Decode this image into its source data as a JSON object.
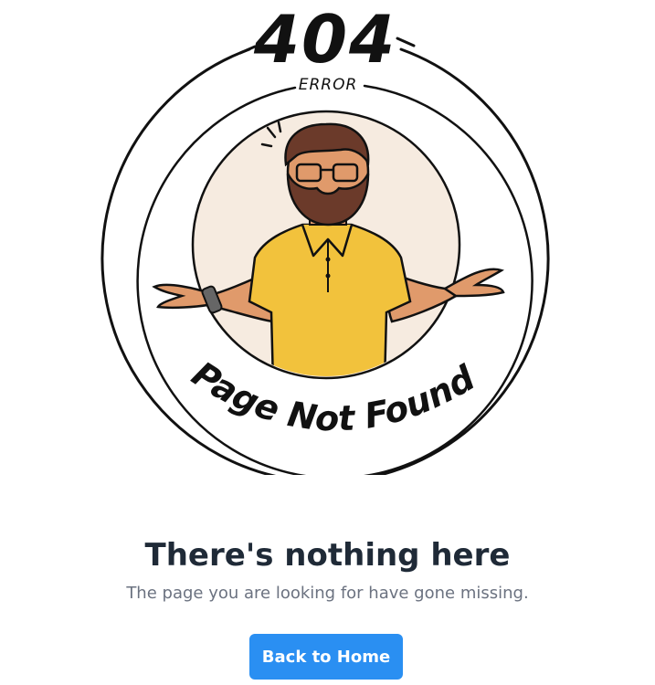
{
  "illustration": {
    "code": "404",
    "error_label": "ERROR",
    "circle_text": "Page Not Found"
  },
  "message": {
    "title": "There's nothing here",
    "description": "The page you are looking for have gone missing."
  },
  "actions": {
    "home_label": "Back to Home"
  },
  "colors": {
    "button": "#2a8ff2",
    "shirt": "#f2c23c",
    "skin": "#e09a6b",
    "beard": "#6b3a2a",
    "circle_fill": "#f6ebe0",
    "title": "#1f2a37",
    "subtext": "#6b7280"
  }
}
